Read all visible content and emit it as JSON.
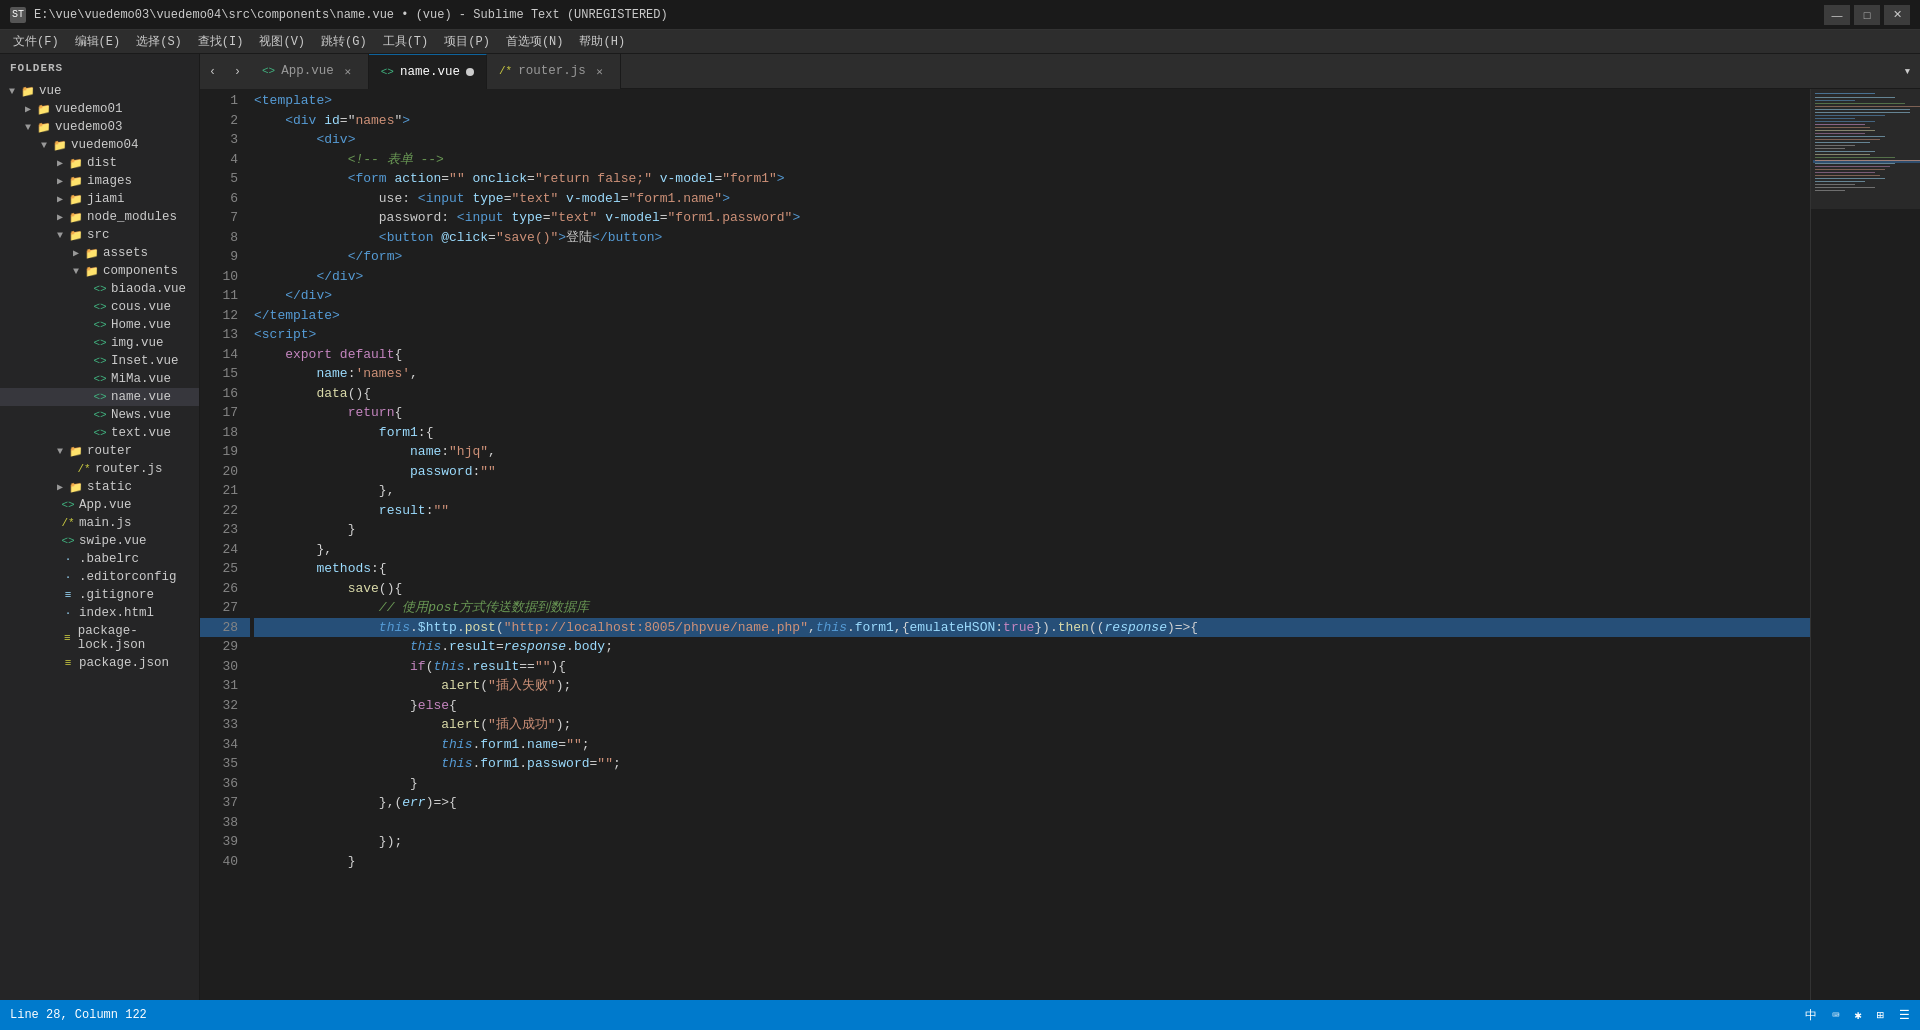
{
  "titleBar": {
    "title": "E:\\vue\\vuedemo03\\vuedemo04\\src\\components\\name.vue • (vue) - Sublime Text (UNREGISTERED)",
    "icon": "ST",
    "buttons": [
      "—",
      "□",
      "✕"
    ]
  },
  "menuBar": {
    "items": [
      "文件(F)",
      "编辑(E)",
      "选择(S)",
      "查找(I)",
      "视图(V)",
      "跳转(G)",
      "工具(T)",
      "项目(P)",
      "首选项(N)",
      "帮助(H)"
    ]
  },
  "sidebar": {
    "title": "FOLDERS",
    "tree": [
      {
        "id": "vue",
        "label": "vue",
        "type": "folder",
        "level": 0,
        "open": true,
        "arrow": "▼"
      },
      {
        "id": "vuedemo01",
        "label": "vuedemo01",
        "type": "folder",
        "level": 1,
        "open": false,
        "arrow": "▶"
      },
      {
        "id": "vuedemo03",
        "label": "vuedemo03",
        "type": "folder",
        "level": 1,
        "open": true,
        "arrow": "▼"
      },
      {
        "id": "vuedemo04",
        "label": "vuedemo04",
        "type": "folder",
        "level": 2,
        "open": true,
        "arrow": "▼"
      },
      {
        "id": "dist",
        "label": "dist",
        "type": "folder",
        "level": 3,
        "open": false,
        "arrow": "▶"
      },
      {
        "id": "images",
        "label": "images",
        "type": "folder",
        "level": 3,
        "open": false,
        "arrow": "▶"
      },
      {
        "id": "jiami",
        "label": "jiami",
        "type": "folder",
        "level": 3,
        "open": false,
        "arrow": "▶"
      },
      {
        "id": "node_modules",
        "label": "node_modules",
        "type": "folder",
        "level": 3,
        "open": false,
        "arrow": "▶"
      },
      {
        "id": "src",
        "label": "src",
        "type": "folder",
        "level": 3,
        "open": true,
        "arrow": "▼"
      },
      {
        "id": "assets",
        "label": "assets",
        "type": "folder",
        "level": 4,
        "open": false,
        "arrow": "▶"
      },
      {
        "id": "components",
        "label": "components",
        "type": "folder",
        "level": 4,
        "open": true,
        "arrow": "▼"
      },
      {
        "id": "biaoda.vue",
        "label": "biaoda.vue",
        "type": "vue",
        "level": 5
      },
      {
        "id": "cous.vue",
        "label": "cous.vue",
        "type": "vue",
        "level": 5
      },
      {
        "id": "Home.vue",
        "label": "Home.vue",
        "type": "vue",
        "level": 5
      },
      {
        "id": "img.vue",
        "label": "img.vue",
        "type": "vue",
        "level": 5
      },
      {
        "id": "Inset.vue",
        "label": "Inset.vue",
        "type": "vue",
        "level": 5
      },
      {
        "id": "MiMa.vue",
        "label": "MiMa.vue",
        "type": "vue",
        "level": 5
      },
      {
        "id": "name.vue",
        "label": "name.vue",
        "type": "vue",
        "level": 5,
        "active": true
      },
      {
        "id": "News.vue",
        "label": "News.vue",
        "type": "vue",
        "level": 5
      },
      {
        "id": "text.vue",
        "label": "text.vue",
        "type": "vue",
        "level": 5
      },
      {
        "id": "router",
        "label": "router",
        "type": "folder",
        "level": 3,
        "open": true,
        "arrow": "▼"
      },
      {
        "id": "router.js",
        "label": "router.js",
        "type": "js",
        "level": 4
      },
      {
        "id": "static",
        "label": "static",
        "type": "folder",
        "level": 3,
        "open": false,
        "arrow": "▶"
      },
      {
        "id": "App.vue2",
        "label": "App.vue",
        "type": "vue",
        "level": 3
      },
      {
        "id": "main.js",
        "label": "main.js",
        "type": "js",
        "level": 3
      },
      {
        "id": "swipe.vue",
        "label": "swipe.vue",
        "type": "vue",
        "level": 3
      },
      {
        "id": ".babelrc",
        "label": ".babelrc",
        "type": "file",
        "level": 3
      },
      {
        "id": ".editorconfig",
        "label": ".editorconfig",
        "type": "file",
        "level": 3
      },
      {
        "id": ".gitignore",
        "label": ".gitignore",
        "type": "file",
        "level": 3
      },
      {
        "id": "index.html",
        "label": "index.html",
        "type": "html",
        "level": 3
      },
      {
        "id": "package-lock.json",
        "label": "package-lock.json",
        "type": "json",
        "level": 3
      },
      {
        "id": "package.json",
        "label": "package.json",
        "type": "json",
        "level": 3
      }
    ]
  },
  "tabs": [
    {
      "id": "app-vue",
      "label": "App.vue",
      "active": false,
      "dot": false,
      "closeable": true
    },
    {
      "id": "name-vue",
      "label": "name.vue",
      "active": true,
      "dot": true,
      "closeable": true
    },
    {
      "id": "router-js",
      "label": "router.js",
      "active": false,
      "dot": false,
      "closeable": true
    }
  ],
  "editor": {
    "filename": "name.vue",
    "highlightedLine": 28,
    "lines": [
      {
        "num": 1,
        "code": "<span class='tag'>&lt;template&gt;</span>"
      },
      {
        "num": 2,
        "code": "    <span class='tag'>&lt;div</span> <span class='attr-name'>id</span><span class='punc'>=</span><span class='attr-value'>\"names\"</span><span class='tag'>&gt;</span>"
      },
      {
        "num": 3,
        "code": "        <span class='tag'>&lt;div&gt;</span>"
      },
      {
        "num": 4,
        "code": "            <span class='comment'>&lt;!-- 表单 --&gt;</span>"
      },
      {
        "num": 5,
        "code": "            <span class='tag'>&lt;form</span> <span class='attr-name'>action</span><span class='punc'>=</span><span class='attr-value'>\"\"</span> <span class='attr-name'>onclick</span><span class='punc'>=</span><span class='attr-value'>\"return false;\"</span> <span class='attr-name'>v-model</span><span class='punc'>=</span><span class='attr-value'>\"form1\"</span><span class='tag'>&gt;</span>"
      },
      {
        "num": 6,
        "code": "                use: <span class='tag'>&lt;input</span> <span class='attr-name'>type</span><span class='punc'>=</span><span class='attr-value'>\"text\"</span> <span class='attr-name'>v-model</span><span class='punc'>=</span><span class='attr-value'>\"form1.name\"</span><span class='tag'>&gt;</span>"
      },
      {
        "num": 7,
        "code": "                password: <span class='tag'>&lt;input</span> <span class='attr-name'>type</span><span class='punc'>=</span><span class='attr-value'>\"text\"</span> <span class='attr-name'>v-model</span><span class='punc'>=</span><span class='attr-value'>\"form1.password\"</span><span class='tag'>&gt;</span>"
      },
      {
        "num": 8,
        "code": "                <span class='tag'>&lt;button</span> <span class='attr-name'>@click</span><span class='punc'>=</span><span class='attr-value'>\"save()\"</span><span class='tag'>&gt;</span><span class='text-white'>登陆</span><span class='tag'>&lt;/button&gt;</span>"
      },
      {
        "num": 9,
        "code": "            <span class='tag'>&lt;/form&gt;</span>"
      },
      {
        "num": 10,
        "code": "        <span class='tag'>&lt;/div&gt;</span>"
      },
      {
        "num": 11,
        "code": "    <span class='tag'>&lt;/div&gt;</span>"
      },
      {
        "num": 12,
        "code": "<span class='tag'>&lt;/template&gt;</span>"
      },
      {
        "num": 13,
        "code": "<span class='tag'>&lt;script&gt;</span>"
      },
      {
        "num": 14,
        "code": "    <span class='keyword'>export default</span><span class='punc'>{</span>"
      },
      {
        "num": 15,
        "code": "        <span class='attr-name'>name</span><span class='punc'>:</span><span class='str'>'names'</span><span class='punc'>,</span>"
      },
      {
        "num": 16,
        "code": "        <span class='func'>data</span><span class='punc'>(){</span>"
      },
      {
        "num": 17,
        "code": "            <span class='keyword'>return</span><span class='punc'>{</span>"
      },
      {
        "num": 18,
        "code": "                <span class='attr-name'>form1</span><span class='punc'>:{</span>"
      },
      {
        "num": 19,
        "code": "                    <span class='attr-name'>name</span><span class='punc'>:</span><span class='str'>\"hjq\"</span><span class='punc'>,</span>"
      },
      {
        "num": 20,
        "code": "                    <span class='attr-name'>password</span><span class='punc'>:</span><span class='str'>\"\"</span>"
      },
      {
        "num": 21,
        "code": "                <span class='punc'>},</span>"
      },
      {
        "num": 22,
        "code": "                <span class='attr-name'>result</span><span class='punc'>:</span><span class='str'>\"\"</span>"
      },
      {
        "num": 23,
        "code": "            <span class='punc'>}</span>"
      },
      {
        "num": 24,
        "code": "        <span class='punc'>},</span>"
      },
      {
        "num": 25,
        "code": "        <span class='attr-name'>methods</span><span class='punc'>:{</span>"
      },
      {
        "num": 26,
        "code": "            <span class='func'>save</span><span class='punc'>(){</span>"
      },
      {
        "num": 27,
        "code": "                <span class='comment'>// 使用post方式传送数据到数据库</span>"
      },
      {
        "num": 28,
        "code": "                <span class='this-kw'>this</span><span class='punc'>.</span><span class='var'>$http</span><span class='punc'>.</span><span class='func'>post</span><span class='punc'>(</span><span class='str'>\"http://localhost:8005/phpvue/name.php\"</span><span class='punc'>,</span><span class='this-kw'>this</span><span class='punc'>.</span><span class='var'>form1</span><span class='punc'>,{</span><span class='attr-name'>emulateHSON</span><span class='punc'>:</span><span class='keyword'>true</span><span class='punc'>}).</span><span class='func'>then</span><span class='punc'>((</span><span class='italic var'>response</span><span class='punc'>)=&gt;{</span>",
        "highlighted": true
      },
      {
        "num": 29,
        "code": "                    <span class='this-kw'>this</span><span class='punc'>.</span><span class='var'>result</span><span class='punc'>=</span><span class='italic var'>response</span><span class='punc'>.</span><span class='var'>body</span><span class='punc'>;</span>"
      },
      {
        "num": 30,
        "code": "                    <span class='keyword'>if</span><span class='punc'>(</span><span class='this-kw'>this</span><span class='punc'>.</span><span class='var'>result</span><span class='punc'>==</span><span class='str'>\"\"</span><span class='punc'>){</span>"
      },
      {
        "num": 31,
        "code": "                        <span class='func'>alert</span><span class='punc'>(</span><span class='str'>\"插入失败\"</span><span class='punc'>);</span>"
      },
      {
        "num": 32,
        "code": "                    <span class='punc'>}</span><span class='keyword'>else</span><span class='punc'>{</span>"
      },
      {
        "num": 33,
        "code": "                        <span class='func'>alert</span><span class='punc'>(</span><span class='str'>\"插入成功\"</span><span class='punc'>);</span>"
      },
      {
        "num": 34,
        "code": "                        <span class='this-kw'>this</span><span class='punc'>.</span><span class='var'>form1</span><span class='punc'>.</span><span class='var'>name</span><span class='punc'>=</span><span class='str'>\"\"</span><span class='punc'>;</span>"
      },
      {
        "num": 35,
        "code": "                        <span class='this-kw'>this</span><span class='punc'>.</span><span class='var'>form1</span><span class='punc'>.</span><span class='var'>password</span><span class='punc'>=</span><span class='str'>\"\"</span><span class='punc'>;</span>"
      },
      {
        "num": 36,
        "code": "                    <span class='punc'>}</span>"
      },
      {
        "num": 37,
        "code": "                <span class='punc'>},(</span><span class='italic var'>err</span><span class='punc'>)=&gt;{</span>"
      },
      {
        "num": 38,
        "code": ""
      },
      {
        "num": 39,
        "code": "                <span class='punc'>});</span>"
      },
      {
        "num": 40,
        "code": "            <span class='punc'>}</span>"
      }
    ]
  },
  "statusBar": {
    "position": "Line 28, Column 122",
    "encoding": "中",
    "icons": [
      "中",
      "⌨",
      "✱",
      "⊞",
      "☰"
    ]
  }
}
